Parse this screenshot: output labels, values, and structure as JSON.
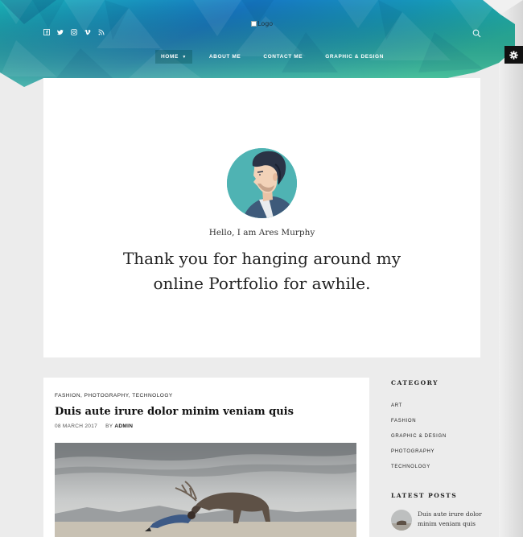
{
  "header": {
    "logo_alt": "Logo",
    "social_icons": [
      "facebook-icon",
      "twitter-icon",
      "instagram-icon",
      "vimeo-icon",
      "rss-icon"
    ],
    "nav": [
      {
        "label": "HOME",
        "active": true,
        "has_dropdown": true
      },
      {
        "label": "ABOUT ME",
        "active": false
      },
      {
        "label": "CONTACT ME",
        "active": false
      },
      {
        "label": "GRAPHIC & DESIGN",
        "active": false
      }
    ],
    "colors": {
      "teal": "#1aa6b7",
      "blue": "#1b6fb8",
      "green": "#6fcf97"
    }
  },
  "hero": {
    "hello": "Hello, I am Ares Murphy",
    "tagline_line1": "Thank you for hanging around my",
    "tagline_line2": "online Portfolio for awhile."
  },
  "post": {
    "categories": "FASHION, PHOTOGRAPHY, TECHNOLOGY",
    "title": "Duis aute irure dolor minim veniam quis",
    "date": "08 MARCH 2017",
    "by": "BY",
    "author": "ADMIN"
  },
  "sidebar": {
    "category_title": "CATEGORY",
    "categories": [
      "ART",
      "FASHION",
      "GRAPHIC & DESIGN",
      "PHOTOGRAPHY",
      "TECHNOLOGY"
    ],
    "latest_title": "LATEST POSTS",
    "latest_post_title": "Duis aute irure dolor minim veniam quis"
  }
}
